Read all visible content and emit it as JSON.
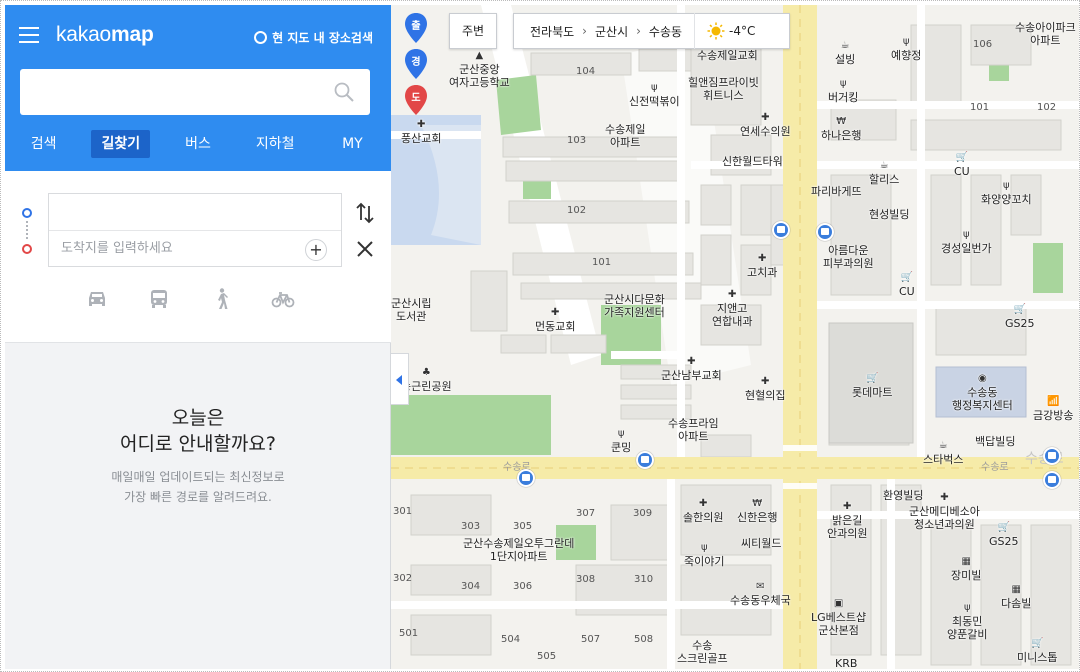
{
  "header": {
    "logo_kakao": "kakao",
    "logo_map": "map",
    "location_search_label": "현 지도 내 장소검색"
  },
  "search": {
    "value": "",
    "placeholder": ""
  },
  "tabs": [
    {
      "label": "검색"
    },
    {
      "label": "길찾기"
    },
    {
      "label": "버스"
    },
    {
      "label": "지하철"
    },
    {
      "label": "MY"
    }
  ],
  "route": {
    "start_value": "",
    "start_placeholder": "",
    "end_placeholder": "도착지를 입력하세요"
  },
  "empty_state": {
    "title_line1": "오늘은",
    "title_line2": "어디로 안내할까요?",
    "desc_line1": "매일매일 업데이트되는 최신정보로",
    "desc_line2": "가장 빠른 경로를 알려드려요."
  },
  "map_controls": {
    "pins": [
      "출",
      "경",
      "도"
    ],
    "nearby": "주변",
    "breadcrumb": [
      "전라북도",
      "군산시",
      "수송동"
    ],
    "temperature": "-4°C"
  },
  "map_labels": {
    "school": [
      "군산중앙",
      "여자고등학교"
    ],
    "pungsan_church": "풍산교회",
    "library": [
      "군산시립",
      "도서관"
    ],
    "park": "송근린공원",
    "apt_sue": [
      "수송제일",
      "아파트"
    ],
    "mundong_church": "먼동교회",
    "family_center": [
      "군산시다문화",
      "가족지원센터"
    ],
    "gunsan_nambu_church": "군산남부교회",
    "suseong_prime": [
      "수송프라임",
      "아파트"
    ],
    "coming": "쿤밍",
    "jeil_church": "수송제일교회",
    "healing": [
      "힐앤짐프라이빗",
      "휘트니스"
    ],
    "sinjeon": "신전떡볶이",
    "yeonse": "연세수의원",
    "shinhan_tower": "신한월드타워",
    "hana_bank": "하나은행",
    "seolbing": "설빙",
    "burger_king": "버거킹",
    "yehyangjeong": "예향정",
    "suseong_ai_apt": [
      "수송아이파크",
      "아파트"
    ],
    "paris": "파리바게뜨",
    "hollys": "할리스",
    "hyunseong": "현성빌딩",
    "areumdaun": [
      "아름다운",
      "피부과의원"
    ],
    "cu1": "CU",
    "cu2": "CU",
    "hwayang": "화양양꼬치",
    "gyeongseong": "경성일번가",
    "gochigwa": "고치과",
    "jiaengo": [
      "지앤고",
      "연합내과"
    ],
    "gs25_1": "GS25",
    "gs25_2": "GS25",
    "lotte_mart": "롯데마트",
    "suseong_center": [
      "수송동",
      "행정복지센터"
    ],
    "geumgang": "금강방송",
    "hyeonhyeol": "현혈의집",
    "baekdap": "백답빌딩",
    "starbucks": "스타벅스",
    "road_susong1": "수송로",
    "road_susong2": "수송로",
    "road_susong3": "수송로",
    "suseong_jeil_apt": [
      "군산수송제일오투그란데",
      "1단지아파트"
    ],
    "sol_hanuiwon": "솔한의원",
    "shinhan_bank": "신한은행",
    "ssiti": "씨티월드",
    "jugiyagi": "죽이야기",
    "post_office": "수송동우체국",
    "hwanyeong": "환영빌딩",
    "bareungil": [
      "밝은길",
      "안과의원"
    ],
    "medibe": [
      "군산메디베소아",
      "청소년과의원"
    ],
    "jangmi": "장미빌",
    "dasom": "다솜빌",
    "choi_galbi": [
      "최동민",
      "양푼갈비"
    ],
    "lg": [
      "LG베스트샵",
      "군산본점"
    ],
    "ministop": "미니스톱",
    "skin_golf": [
      "수송",
      "스크린골프"
    ],
    "krb": "KRB",
    "bldg_numbers": [
      "104",
      "103",
      "102",
      "101",
      "106",
      "101",
      "102",
      "301",
      "303",
      "305",
      "307",
      "309",
      "302",
      "304",
      "306",
      "308",
      "310",
      "501",
      "504",
      "505",
      "507",
      "508"
    ]
  },
  "colors": {
    "brand_blue": "#2f8cf0",
    "active_tab": "#1c64c9",
    "road_yellow": "#f6eba8",
    "park_green": "#a8d59c",
    "water_blue": "#c9d9ef"
  }
}
